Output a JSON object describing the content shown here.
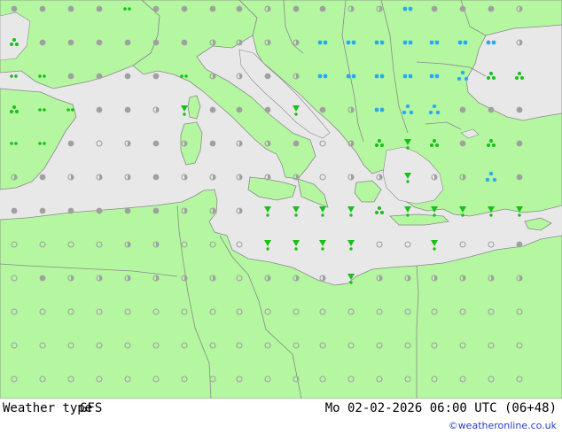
{
  "map": {
    "product": "Weather type",
    "model": "GFS",
    "valid_time": "Mo 02-02-2026 06:00 UTC (06+48)",
    "credit": "©weatheronline.co.uk",
    "colors": {
      "land": "#b4f7a0",
      "sea": "#e8e8e8",
      "border": "#8a8a8a",
      "dry_symbol": "#a0a0a0",
      "rain_symbol": "#18c018",
      "snow_symbol": "#1aa0ff"
    },
    "legend_icons": {
      "dot": "dry-dot-icon",
      "ring": "dry-ring-icon",
      "half": "half-ring-icon",
      "drizzle": "drizzle-icon",
      "showers": "rain-showers-icon",
      "rain": "rain-icon",
      "snow": "snow-icon",
      "snowshowers": "snow-showers-icon"
    }
  }
}
